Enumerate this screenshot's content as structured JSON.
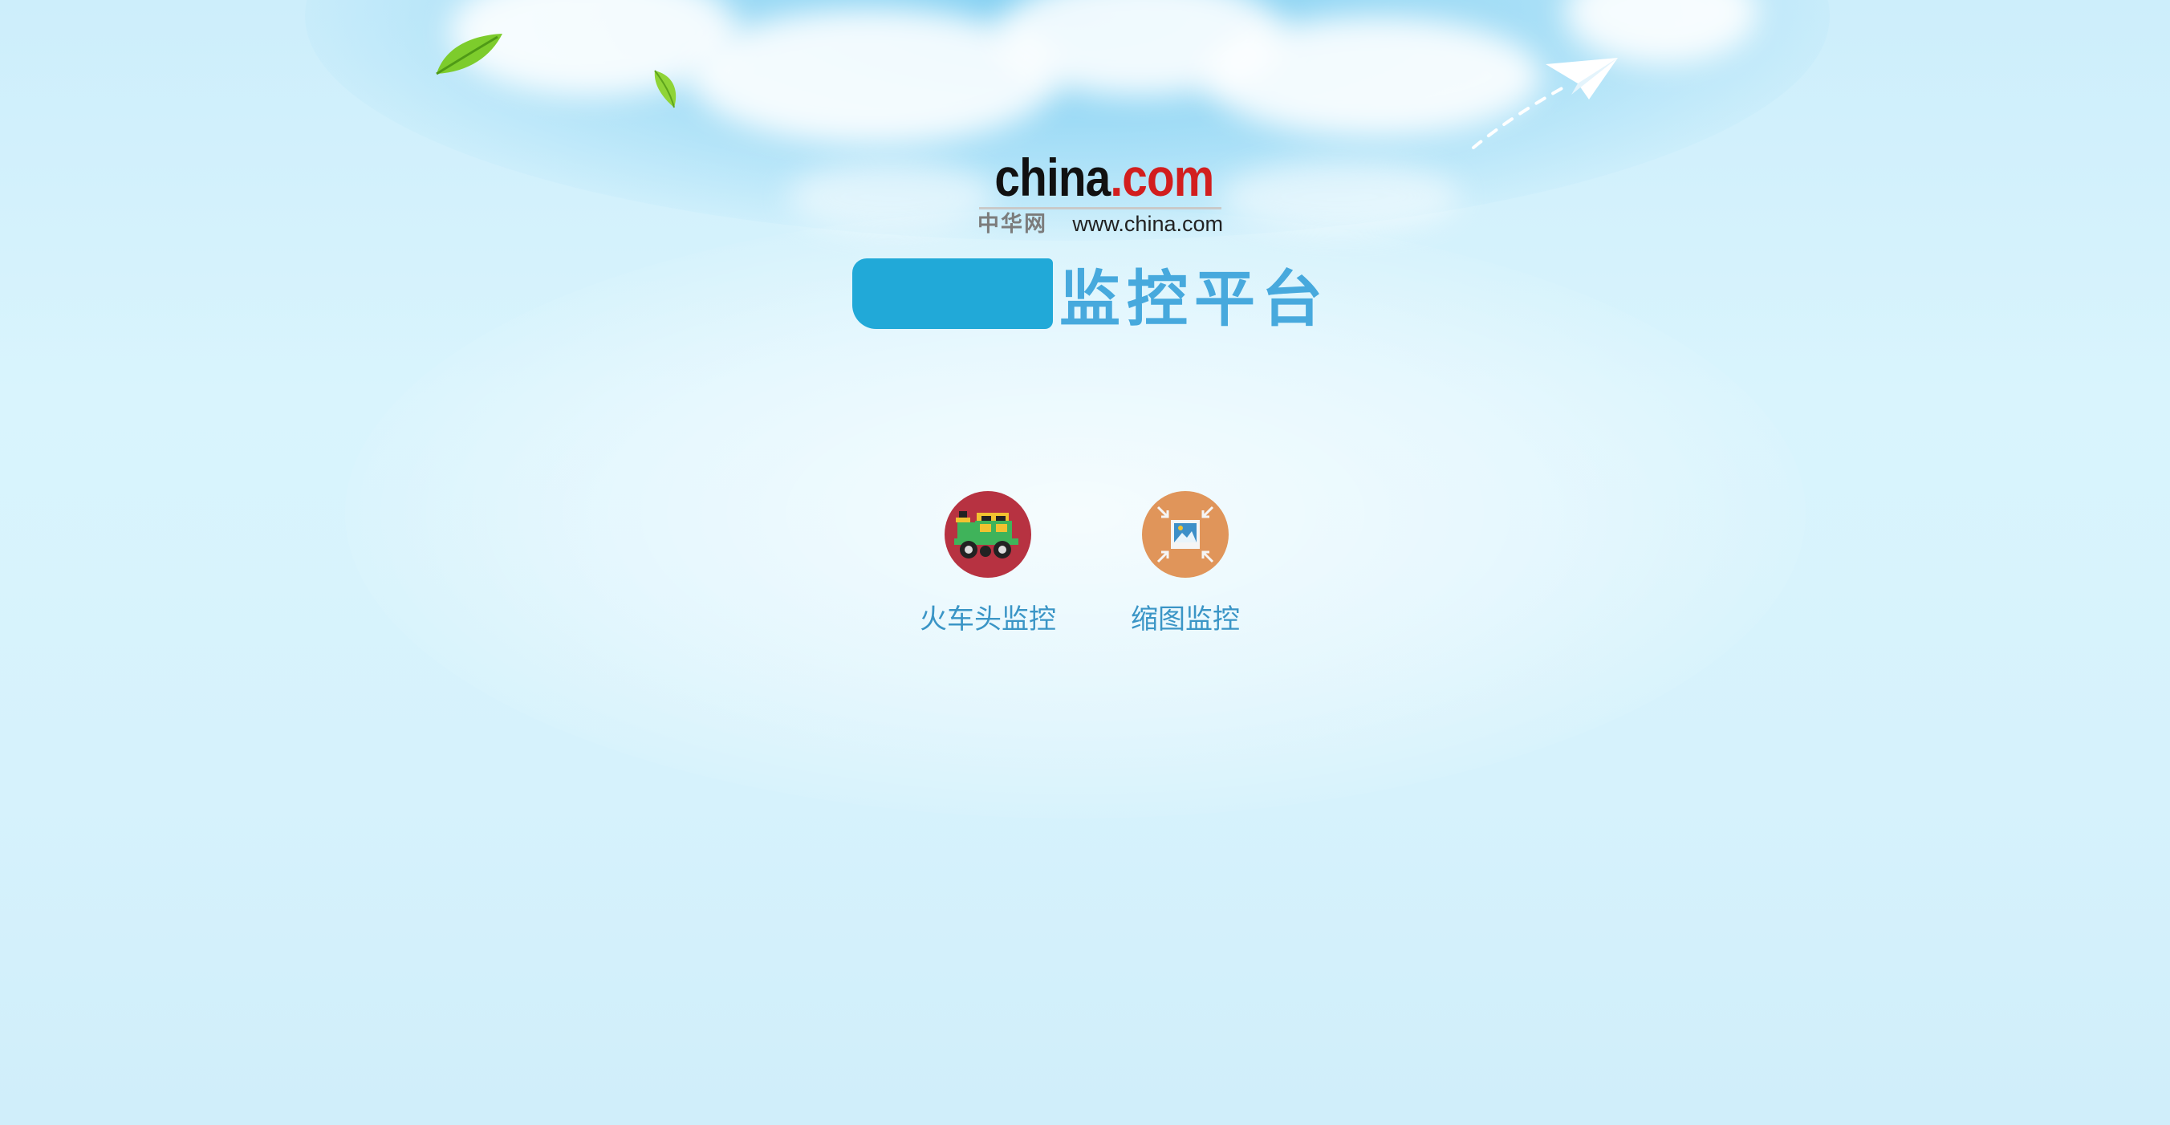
{
  "logo": {
    "brand_main": "china",
    "brand_suffix": ".com",
    "chinese_name": "中华网",
    "url": "www.china.com"
  },
  "header": {
    "title_suffix": "监控平台"
  },
  "apps": [
    {
      "label": "火车头监控",
      "icon": "train-icon",
      "color": "#b73241"
    },
    {
      "label": "缩图监控",
      "icon": "image-resize-icon",
      "color": "#e0955a"
    }
  ],
  "colors": {
    "background": "#d4f1fc",
    "title": "#47a9dd",
    "label": "#3a95c6",
    "redaction": "#21a9d8"
  }
}
